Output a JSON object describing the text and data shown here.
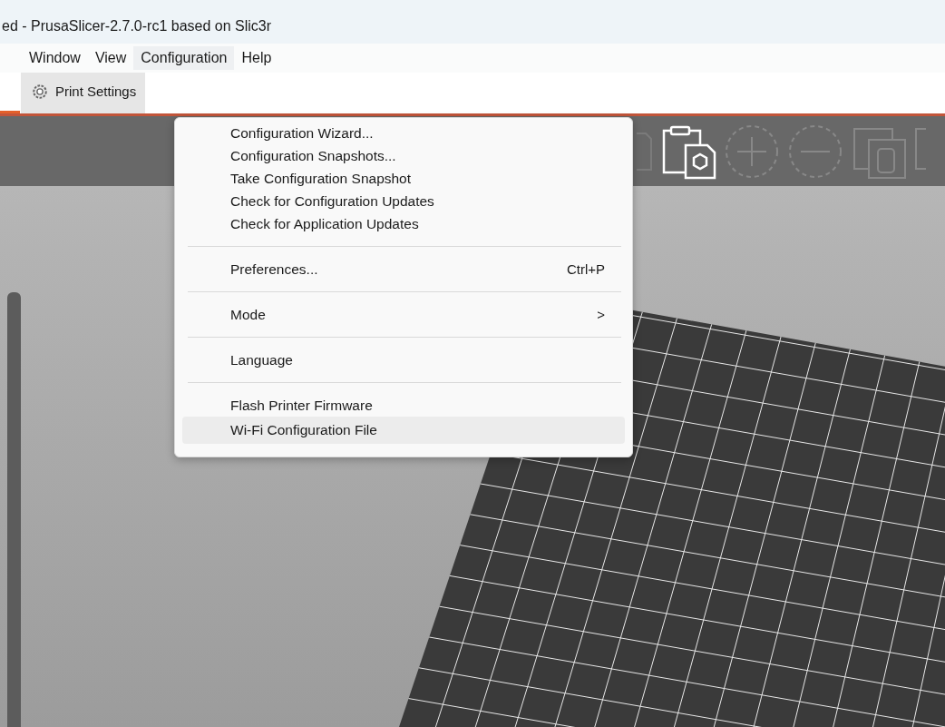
{
  "window": {
    "title": "ed - PrusaSlicer-2.7.0-rc1 based on Slic3r"
  },
  "menu_bar": [
    {
      "label": "Window",
      "selected": false
    },
    {
      "label": "View",
      "selected": false
    },
    {
      "label": "Configuration",
      "selected": true
    },
    {
      "label": "Help",
      "selected": false
    }
  ],
  "tabs": [
    {
      "label": "Print Settings",
      "selected": false
    }
  ],
  "menu": {
    "items": [
      {
        "kind": "item",
        "label": "Configuration Wizard...",
        "selected": false
      },
      {
        "kind": "item",
        "label": "Configuration Snapshots...",
        "selected": false
      },
      {
        "kind": "item",
        "label": "Take Configuration Snapshot",
        "selected": false
      },
      {
        "kind": "item",
        "label": "Check for Configuration Updates",
        "selected": false
      },
      {
        "kind": "item",
        "label": "Check for Application Updates",
        "selected": false
      },
      {
        "kind": "separator"
      },
      {
        "kind": "item",
        "label": "Preferences...",
        "shortcut": "Ctrl+P",
        "selected": false
      },
      {
        "kind": "separator"
      },
      {
        "kind": "submenu",
        "label": "Mode",
        "arrow": ">",
        "selected": false
      },
      {
        "kind": "separator"
      },
      {
        "kind": "item",
        "label": "Language",
        "selected": false
      },
      {
        "kind": "separator"
      },
      {
        "kind": "item",
        "label": "Flash Printer Firmware",
        "selected": false
      },
      {
        "kind": "item",
        "label": "Wi-Fi Configuration File",
        "selected": true
      }
    ]
  }
}
